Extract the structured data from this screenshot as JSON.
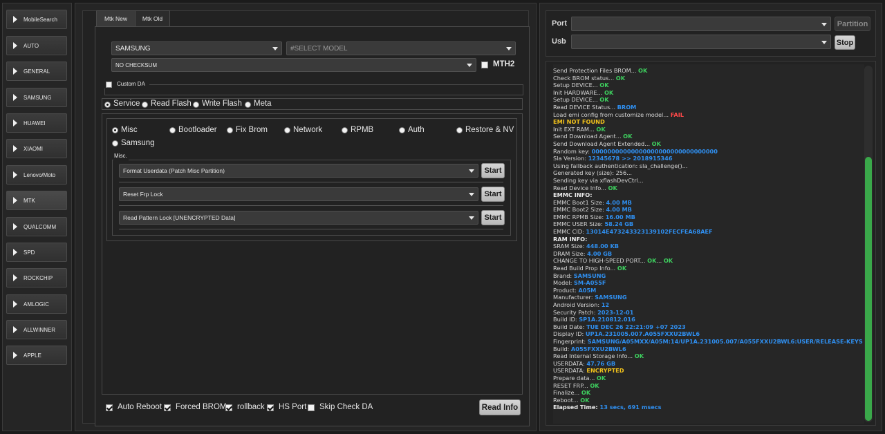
{
  "sidebar": {
    "items": [
      {
        "label": "MobileSearch"
      },
      {
        "label": "AUTO"
      },
      {
        "label": "GENERAL"
      },
      {
        "label": "SAMSUNG"
      },
      {
        "label": "HUAWEI"
      },
      {
        "label": "XIAOMI"
      },
      {
        "label": "Lenovo/Moto"
      },
      {
        "label": "MTK"
      },
      {
        "label": "QUALCOMM"
      },
      {
        "label": "SPD"
      },
      {
        "label": "ROCKCHIP"
      },
      {
        "label": "AMLOGIC"
      },
      {
        "label": "ALLWINNER"
      },
      {
        "label": "APPLE"
      }
    ],
    "active": "MTK"
  },
  "tabs": {
    "mtk_new": "Mtk New",
    "mtk_old": "Mtk Old"
  },
  "brand_select": "SAMSUNG",
  "model_select": "#SELECT MODEL",
  "checksum_select": "NO CHECKSUM",
  "mth2_label": "MTH2",
  "custom_da_label": "Custom DA",
  "modes": {
    "service": "Service",
    "read_flash": "Read Flash",
    "write_flash": "Write Flash",
    "meta": "Meta"
  },
  "ops": {
    "misc": "Misc",
    "bootloader": "Bootloader",
    "fix_brom": "Fix Brom",
    "network": "Network",
    "rpmb": "RPMB",
    "auth": "Auth",
    "restore_nv": "Restore & NV",
    "samsung": "Samsung"
  },
  "misc_group": "Misc.",
  "misc_actions": [
    {
      "value": "Format Userdata (Patch Misc Partition)",
      "button": "Start"
    },
    {
      "value": "Reset Frp Lock",
      "button": "Start"
    },
    {
      "value": "Read Pattern Lock [UNENCRYPTED Data]",
      "button": "Start"
    }
  ],
  "bottom": {
    "auto_reboot": "Auto Reboot",
    "forced_brom": "Forced BROM",
    "rollback": "rollback",
    "hs_port": "HS Port",
    "skip_check_da": "Skip Check DA",
    "read_info": "Read Info"
  },
  "connection": {
    "port_label": "Port",
    "usb_label": "Usb",
    "partition_button": "Partition",
    "stop_button": "Stop"
  },
  "colors": {
    "ok": "#3ecf5e",
    "info": "#2f8ff0",
    "fail": "#ff4848",
    "warn": "#f2c21b",
    "accent_scroll": "#3aa84a"
  },
  "log": [
    [
      [
        "Send Protection Files BROM... ",
        "n"
      ],
      [
        "OK",
        "ok"
      ]
    ],
    [
      [
        "Check BROM status... ",
        "n"
      ],
      [
        "OK",
        "ok"
      ]
    ],
    [
      [
        "Setup DEVICE... ",
        "n"
      ],
      [
        "OK",
        "ok"
      ]
    ],
    [
      [
        "Init HARDWARE... ",
        "n"
      ],
      [
        "OK",
        "ok"
      ]
    ],
    [
      [
        "Setup DEVICE... ",
        "n"
      ],
      [
        "OK",
        "ok"
      ]
    ],
    [
      [
        "Read DEVICE Status... ",
        "n"
      ],
      [
        "BROM",
        "info"
      ]
    ],
    [
      [
        "Load emi config from customize model... ",
        "n"
      ],
      [
        "FAIL",
        "fail"
      ]
    ],
    [
      [
        "   EMI NOT FOUND",
        "warn"
      ]
    ],
    [
      [
        "Init EXT RAM... ",
        "n"
      ],
      [
        "OK",
        "ok"
      ]
    ],
    [
      [
        "Send Download Agent... ",
        "n"
      ],
      [
        "OK",
        "ok"
      ]
    ],
    [
      [
        "Send Download Agent Extended... ",
        "n"
      ],
      [
        "OK",
        "ok"
      ]
    ],
    [
      [
        "Random key:  ",
        "n"
      ],
      [
        "00000000000000000000000000000000",
        "info"
      ]
    ],
    [
      [
        "Sla Version:  ",
        "n"
      ],
      [
        "12345678  >> 2018915346",
        "info"
      ]
    ],
    [
      [
        "Using fallback authentication: sla_challenge()...",
        "n"
      ]
    ],
    [
      [
        "Generated key (size): 256...",
        "n"
      ]
    ],
    [
      [
        "Sending key via xflashDevCtrl...",
        "n"
      ]
    ],
    [
      [
        "Read Device Info... ",
        "n"
      ],
      [
        "OK",
        "ok"
      ]
    ],
    [
      [
        "EMMC INFO:",
        "b"
      ]
    ],
    [
      [
        "EMMC Boot1 Size: ",
        "n"
      ],
      [
        "4.00 MB",
        "info"
      ]
    ],
    [
      [
        "EMMC Boot2 Size: ",
        "n"
      ],
      [
        "4.00 MB",
        "info"
      ]
    ],
    [
      [
        "EMMC RPMB Size: ",
        "n"
      ],
      [
        "16.00 MB",
        "info"
      ]
    ],
    [
      [
        "EMMC USER Size: ",
        "n"
      ],
      [
        "58.24 GB",
        "info"
      ]
    ],
    [
      [
        "EMMC CID: ",
        "n"
      ],
      [
        "13014E473243323139102FECFEA68AEF",
        "info"
      ]
    ],
    [
      [
        "RAM INFO:",
        "b"
      ]
    ],
    [
      [
        "SRAM Size: ",
        "n"
      ],
      [
        "448.00 KB",
        "info"
      ]
    ],
    [
      [
        "DRAM Size: ",
        "n"
      ],
      [
        "4.00 GB",
        "info"
      ]
    ],
    [
      [
        "CHANGE TO HIGH-SPEED PORT... ",
        "n"
      ],
      [
        "OK",
        "ok"
      ],
      [
        "... ",
        "n"
      ],
      [
        "OK",
        "ok"
      ]
    ],
    [
      [
        "Read Build Prop Info... ",
        "n"
      ],
      [
        "OK",
        "ok"
      ]
    ],
    [
      [
        " Brand: ",
        "n"
      ],
      [
        "SAMSUNG",
        "info"
      ]
    ],
    [
      [
        " Model: ",
        "n"
      ],
      [
        "SM-A055F",
        "info"
      ]
    ],
    [
      [
        " Product: ",
        "n"
      ],
      [
        "A05M",
        "info"
      ]
    ],
    [
      [
        " Manufacturer: ",
        "n"
      ],
      [
        "SAMSUNG",
        "info"
      ]
    ],
    [
      [
        " Android Version: ",
        "n"
      ],
      [
        "12",
        "info"
      ]
    ],
    [
      [
        " Security Patch: ",
        "n"
      ],
      [
        "2023-12-01",
        "info"
      ]
    ],
    [
      [
        " Build ID: ",
        "n"
      ],
      [
        "SP1A.210812.016",
        "info"
      ]
    ],
    [
      [
        " Build Date: ",
        "n"
      ],
      [
        "TUE DEC 26 22:21:09 +07 2023",
        "info"
      ]
    ],
    [
      [
        " Display ID: ",
        "n"
      ],
      [
        "UP1A.231005.007.A055FXXU2BWL6",
        "info"
      ]
    ],
    [
      [
        " Fingerprint: ",
        "n"
      ],
      [
        "SAMSUNG/A05MXX/A05M:14/UP1A.231005.007/A055FXXU2BWL6:USER/RELEASE-KEYS",
        "info"
      ]
    ],
    [
      [
        " Build: ",
        "n"
      ],
      [
        "A055FXXU2BWL6",
        "info"
      ]
    ],
    [
      [
        "Read Internal Storage Info... ",
        "n"
      ],
      [
        "OK",
        "ok"
      ]
    ],
    [
      [
        "USERDATA: ",
        "n"
      ],
      [
        "47.76 GB",
        "info"
      ]
    ],
    [
      [
        "USERDATA: ",
        "n"
      ],
      [
        "ENCRYPTED",
        "warn"
      ]
    ],
    [
      [
        "Prepare data... ",
        "n"
      ],
      [
        "OK",
        "ok"
      ]
    ],
    [
      [
        "RESET FRP... ",
        "n"
      ],
      [
        "OK",
        "ok"
      ]
    ],
    [
      [
        "Finalize... ",
        "n"
      ],
      [
        "OK",
        "ok"
      ]
    ],
    [
      [
        "Reboot... ",
        "n"
      ],
      [
        "OK",
        "ok"
      ]
    ],
    [
      [
        "Elapsed Time: ",
        "b"
      ],
      [
        "13 secs, 691 msecs",
        "info"
      ]
    ]
  ]
}
